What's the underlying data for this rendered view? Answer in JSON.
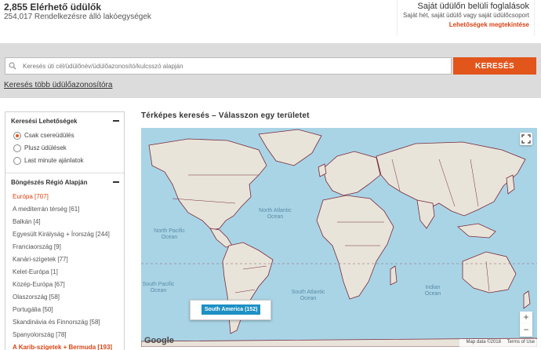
{
  "stats": {
    "available": "2,855 Elérhető üdülők",
    "units": "254,017 Rendelkezésre álló lakóegységek"
  },
  "own_booking": {
    "title": "Saját üdülőn belüli foglalások",
    "subtitle": "Saját hét, saját üdülő vagy saját üdülőcsoport",
    "link": "Lehetőségek megtekintése"
  },
  "search": {
    "placeholder": "Keresés úti cél/üdülőnév/üdülőazonosító/kulcsszó alapján",
    "button": "KERESÉS",
    "multi_link": "Keresés több üdülőazonosítóra"
  },
  "sidebar": {
    "options_title": "Keresési Lehetőségek",
    "options": [
      {
        "label": "Csak csereüdülés",
        "selected": true
      },
      {
        "label": "Plusz üdülések",
        "selected": false
      },
      {
        "label": "Last minute ajánlatok",
        "selected": false
      }
    ],
    "regions_title": "Böngészés Régió Alapján",
    "regions": [
      {
        "label": "Európa [707]",
        "style": "hl"
      },
      {
        "label": "A mediterrán térség [61]",
        "style": "normal"
      },
      {
        "label": "Balkán [4]",
        "style": "normal"
      },
      {
        "label": "Egyesült Királyság + Írország [244]",
        "style": "normal"
      },
      {
        "label": "Franciaország [9]",
        "style": "normal"
      },
      {
        "label": "Kanári-szigetek [77]",
        "style": "normal"
      },
      {
        "label": "Kelet-Európa [1]",
        "style": "normal"
      },
      {
        "label": "Közép-Európa [67]",
        "style": "normal"
      },
      {
        "label": "Olaszország [58]",
        "style": "normal"
      },
      {
        "label": "Portugália [50]",
        "style": "normal"
      },
      {
        "label": "Skandinávia és Finnország [58]",
        "style": "normal"
      },
      {
        "label": "Spanyolország [78]",
        "style": "normal"
      },
      {
        "label": "A Karib-szigetek + Bermuda [193]",
        "style": "bold"
      }
    ]
  },
  "map": {
    "title": "Térképes keresés – Válasszon egy területet",
    "tooltip": "South America (152)",
    "oceans": {
      "north_atlantic": "North Atlantic Ocean",
      "south_atlantic": "South Atlantic Ocean",
      "north_pacific": "North Pacific Ocean",
      "south_pacific": "South Pacific Ocean",
      "indian": "Indian Ocean"
    },
    "zoom_in": "+",
    "zoom_out": "−",
    "google": "Google",
    "map_data": "Map data ©2018",
    "terms": "Terms of Use"
  },
  "colors": {
    "accent": "#e2551b",
    "tooltip_badge": "#1e90c4",
    "water": "#a9d4e6",
    "land": "#e8e4da",
    "border": "#7a2a3a"
  }
}
